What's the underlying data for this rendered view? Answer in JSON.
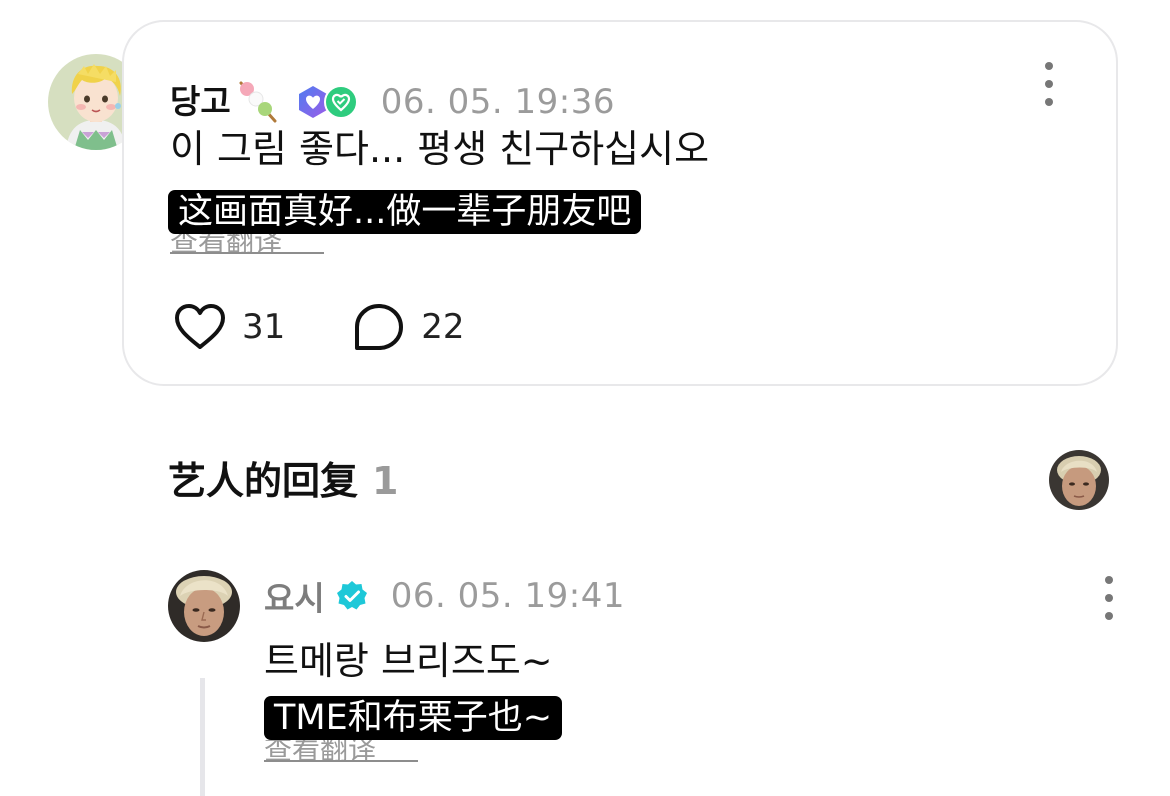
{
  "comment": {
    "username": "당고",
    "timestamp": "06. 05. 19:36",
    "text": "이 그림 좋다... 평생 친구하십시오",
    "translation": "这画面真好...做一辈子朋友吧",
    "translate_link": "查看翻译",
    "likes": "31",
    "replies": "22",
    "icons": {
      "username_emoji": "dango-icon",
      "badges": [
        "hexagon-heart-badge-icon",
        "heart-badge-icon"
      ],
      "more": "more-vertical-icon",
      "like": "heart-outline-icon",
      "reply": "speech-bubble-icon"
    }
  },
  "artist_replies": {
    "title": "艺人的回复",
    "count": "1"
  },
  "reply": {
    "username": "요시",
    "timestamp": "06. 05. 19:41",
    "text": "트메랑 브리즈도~",
    "translation": "TME和布栗子也~",
    "translate_link": "查看翻译",
    "icons": {
      "verified": "verified-badge-icon",
      "more": "more-vertical-icon"
    }
  },
  "colors": {
    "verified": "#1ec8d8",
    "badge_blue": "#4f7df0",
    "badge_purple": "#9a5ce8",
    "badge_green": "#2ecc7e",
    "muted_text": "#9b9b9b",
    "card_border": "#e8e8ea"
  }
}
